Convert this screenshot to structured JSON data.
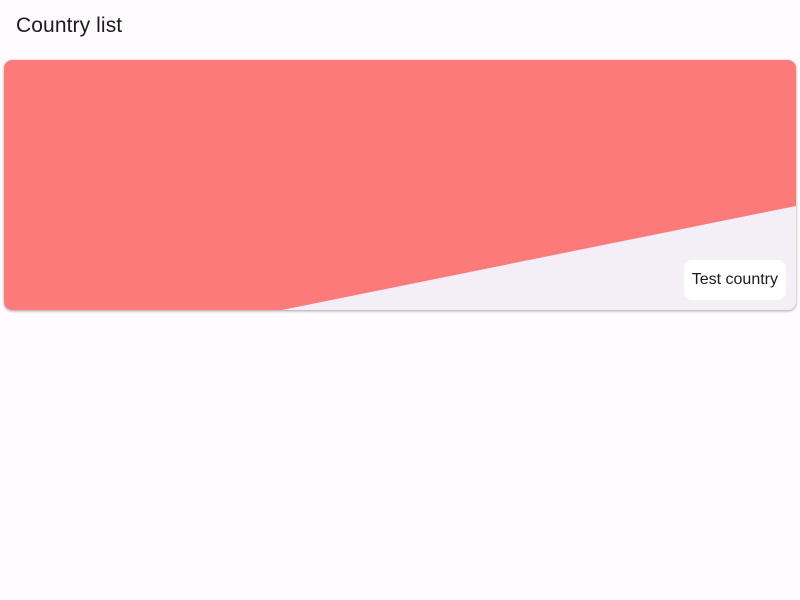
{
  "app_bar": {
    "title": "Country list"
  },
  "countries": [
    {
      "name": "Test country",
      "flag_color": "#fc7a7a",
      "card_background": "#f4eff7"
    }
  ],
  "colors": {
    "page_background": "#fffbfe",
    "label_background": "#ffffff",
    "text": "#1c1b1f"
  }
}
